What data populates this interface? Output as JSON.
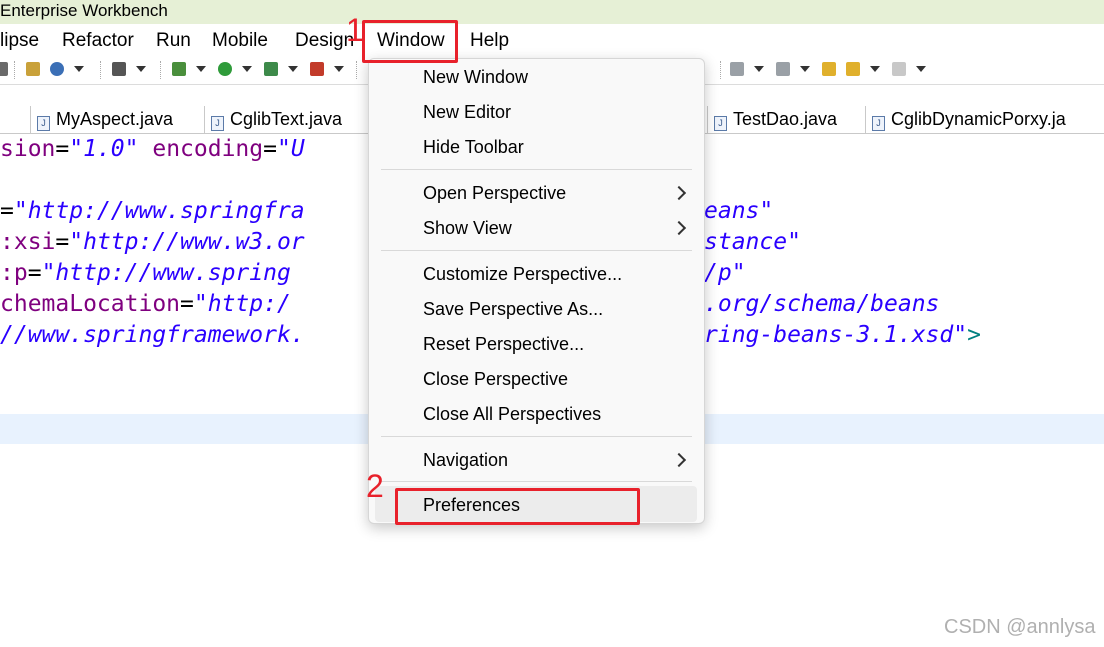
{
  "window": {
    "title": "Enterprise Workbench"
  },
  "menubar": {
    "items": [
      {
        "label": "lipse"
      },
      {
        "label": "Refactor"
      },
      {
        "label": "Run"
      },
      {
        "label": "Mobile"
      },
      {
        "label": "Design"
      },
      {
        "label": "Window"
      },
      {
        "label": "Help"
      }
    ]
  },
  "tabs": [
    {
      "label": ""
    },
    {
      "label": "MyAspect.java"
    },
    {
      "label": "CglibText.java"
    },
    {
      "label": "TestDao.java"
    },
    {
      "label": "CglibDynamicPorxy.ja"
    }
  ],
  "editor": {
    "lines": [
      {
        "attr": "sion",
        "eq": "=",
        "str": "\"1.0\"",
        "attr2": " encoding",
        "eq2": "=",
        "str2": "\"U"
      },
      {
        "attr": "",
        "eq": "=",
        "str": "\"http://www.springfra",
        "str_tail": "eans\""
      },
      {
        "attr": ":xsi",
        "eq": "=",
        "str": "\"http://www.w3.or",
        "str_tail": "stance\""
      },
      {
        "attr": ":p",
        "eq": "=",
        "str": "\"http://www.spring",
        "str_tail": "/p\""
      },
      {
        "attr": "chemaLocation",
        "eq": "=",
        "str": "\"http:/",
        "str_tail": ".org/schema/beans"
      },
      {
        "str": "//www.springframework.",
        "str_tail": "ring-beans-3.1.xsd\"",
        "tag": ">"
      }
    ]
  },
  "window_menu": {
    "items": [
      {
        "label": "New Window"
      },
      {
        "label": "New Editor"
      },
      {
        "label": "Hide Toolbar"
      },
      {
        "label": "Open Perspective"
      },
      {
        "label": "Show View"
      },
      {
        "label": "Customize Perspective..."
      },
      {
        "label": "Save Perspective As..."
      },
      {
        "label": "Reset Perspective..."
      },
      {
        "label": "Close Perspective"
      },
      {
        "label": "Close All Perspectives"
      },
      {
        "label": "Navigation"
      },
      {
        "label": "Preferences"
      }
    ]
  },
  "annotations": {
    "step1": "1",
    "step2": "2",
    "color": "#e8212b"
  },
  "watermark": "CSDN @annlysa"
}
